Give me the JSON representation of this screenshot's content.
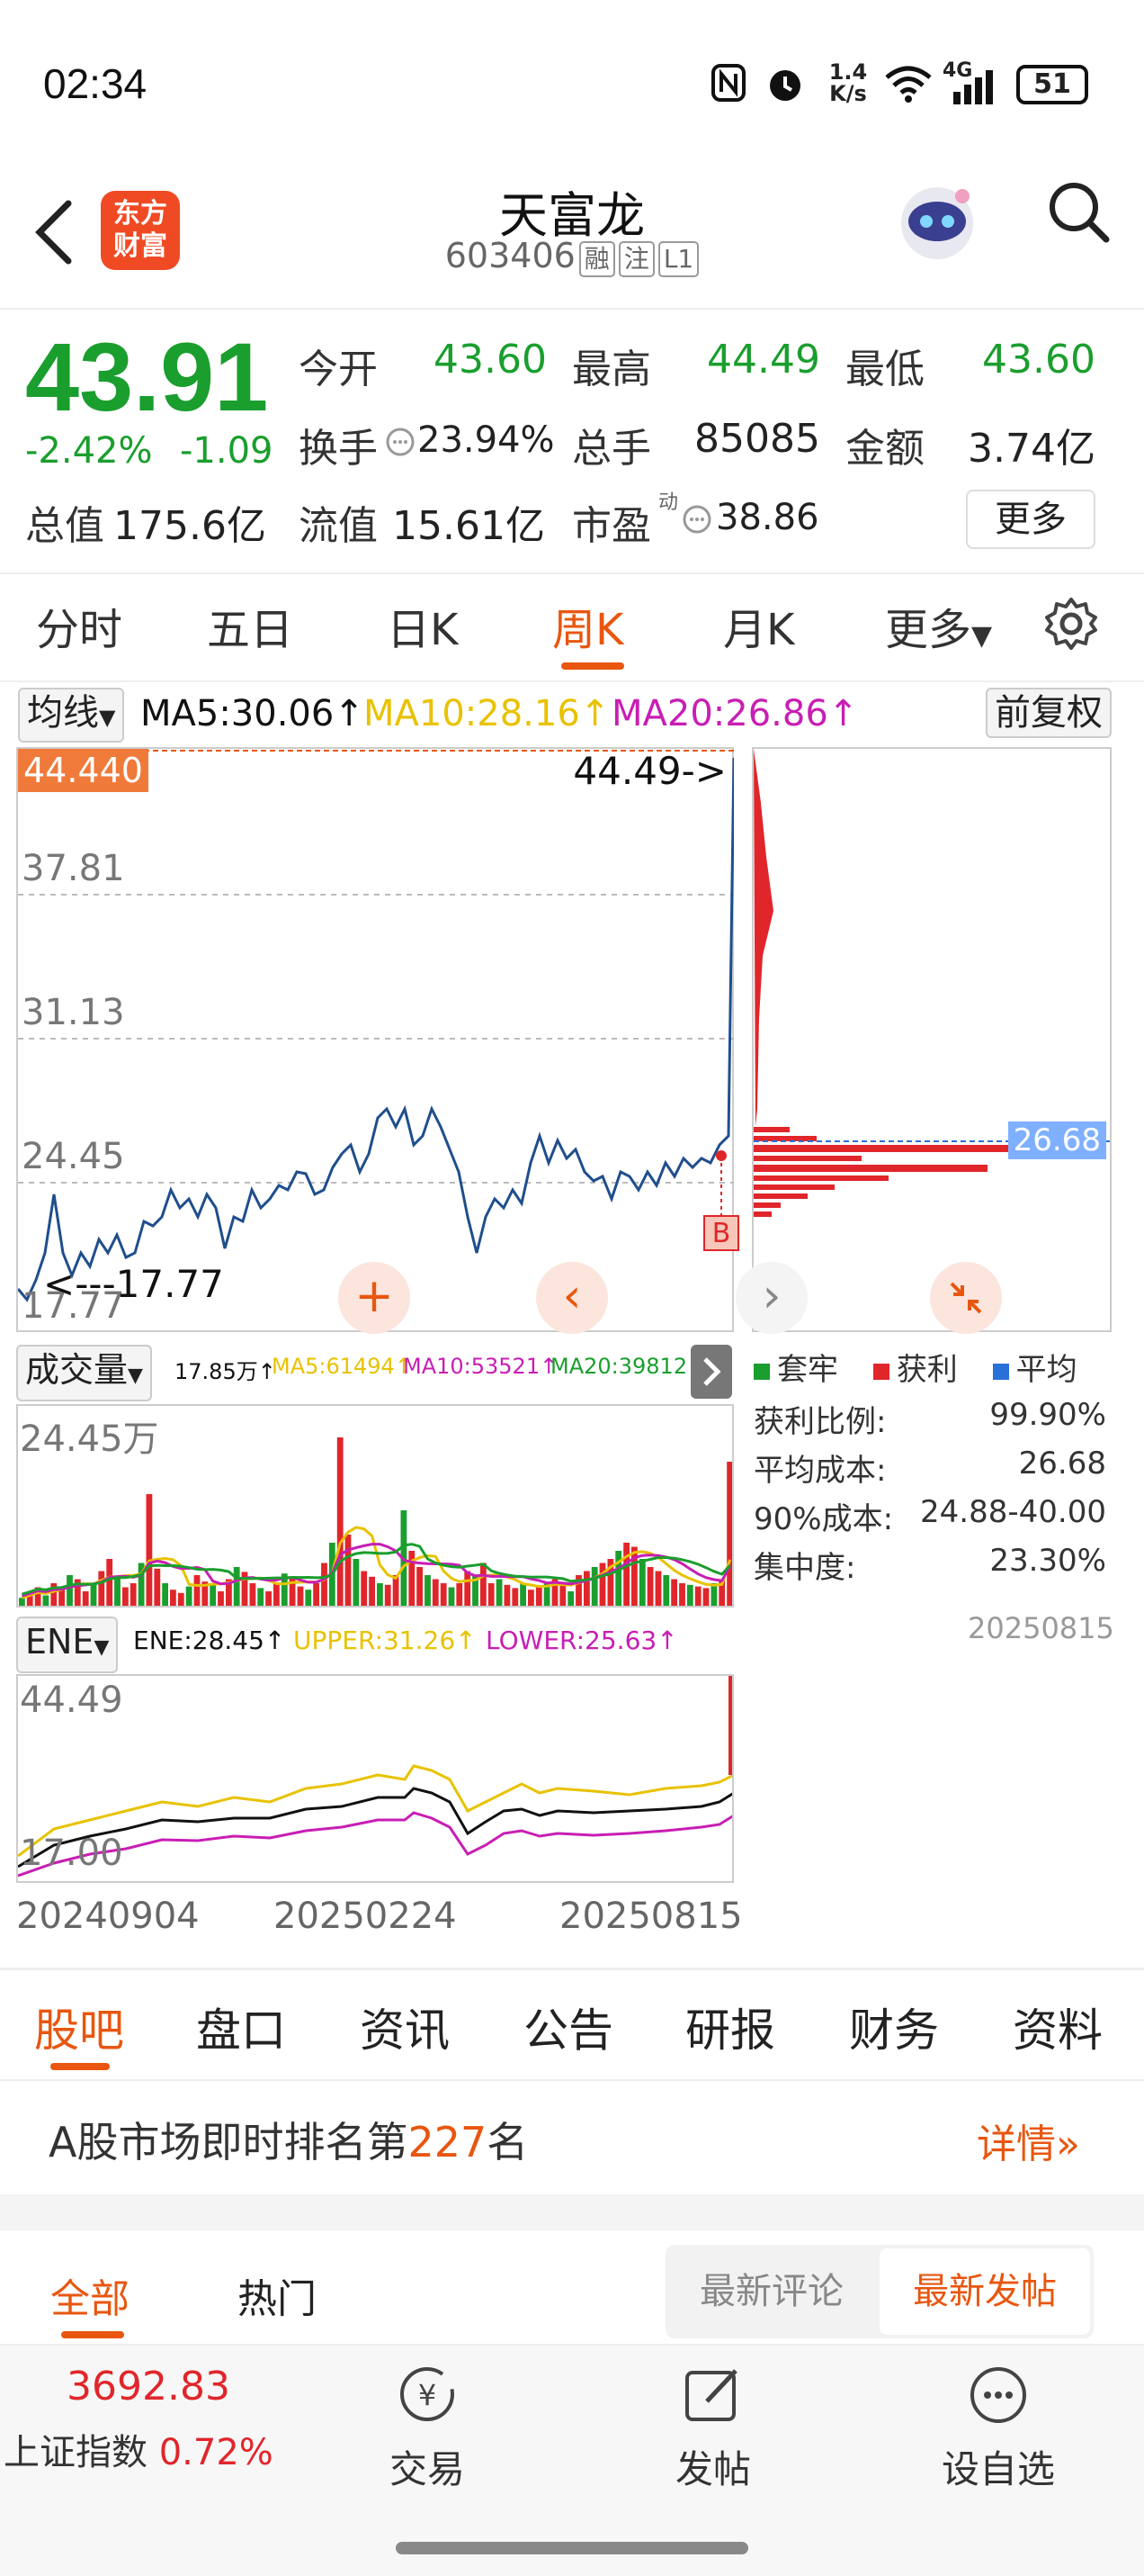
{
  "status": {
    "time": "02:34",
    "speed_top": "1.4",
    "speed_bottom": "K/s",
    "battery": "51",
    "network": "4G"
  },
  "header": {
    "logo_line1": "东方",
    "logo_line2": "财富",
    "title": "天富龙",
    "code": "603406",
    "tags": [
      "融",
      "注",
      "L1"
    ]
  },
  "quote": {
    "price": "43.91",
    "change_pct": "-2.42%",
    "change": "-1.09",
    "fields": [
      {
        "label": "今开",
        "value": "43.60",
        "color": "green"
      },
      {
        "label": "最高",
        "value": "44.49",
        "color": "green"
      },
      {
        "label": "最低",
        "value": "43.60",
        "color": "green"
      },
      {
        "label": "换手",
        "value": "23.94%",
        "color": "dark"
      },
      {
        "label": "总手",
        "value": "85085",
        "color": "dark"
      },
      {
        "label": "金额",
        "value": "3.74亿",
        "color": "dark"
      },
      {
        "label": "总值",
        "value": "175.6亿",
        "color": "dark"
      },
      {
        "label": "流值",
        "value": "15.61亿",
        "color": "dark"
      },
      {
        "label": "市盈",
        "value": "38.86",
        "color": "dark"
      }
    ],
    "pe_superscript": "动",
    "more_label": "更多"
  },
  "tabs": [
    "分时",
    "五日",
    "日K",
    "周K",
    "月K",
    "更多"
  ],
  "active_tab": "周K",
  "ma_bar": {
    "selector": "均线",
    "ma5": "MA5:30.06↑",
    "ma10": "MA10:28.16↑",
    "ma20": "MA20:26.86↑",
    "adjust": "前复权"
  },
  "kline": {
    "high_tag": "44.440",
    "y_labels": [
      "37.81",
      "31.13",
      "24.45",
      "17.77"
    ],
    "max_annot": "44.49->",
    "min_annot": "<---17.77",
    "buy_marker": "B"
  },
  "chip": {
    "avg_tag": "26.68",
    "legend": [
      "套牢",
      "获利",
      "平均"
    ],
    "stats": [
      {
        "label": "获利比例:",
        "value": "99.90%"
      },
      {
        "label": "平均成本:",
        "value": "26.68"
      },
      {
        "label": "90%成本:",
        "value": "24.88-40.00"
      },
      {
        "label": "集中度:",
        "value": "23.30%"
      }
    ],
    "date": "20250815"
  },
  "volume": {
    "selector": "成交量",
    "current": "17.85万↑",
    "ma5": "MA5:61494↑",
    "ma10": "MA10:53521↑",
    "ma20": "MA20:39812↑",
    "max_label": "24.45万"
  },
  "ene": {
    "selector": "ENE",
    "ene": "ENE:28.45↑",
    "upper": "UPPER:31.26↑",
    "lower": "LOWER:25.63↑",
    "max_label": "44.49",
    "min_label": "17.00"
  },
  "x_axis": [
    "20240904",
    "20250224",
    "20250815"
  ],
  "sub_tabs": [
    "股吧",
    "盘口",
    "资讯",
    "公告",
    "研报",
    "财务",
    "资料"
  ],
  "active_sub_tab": "股吧",
  "ranking": {
    "prefix": "A股市场即时排名第",
    "rank": "227",
    "suffix": "名",
    "detail": "详情"
  },
  "feed_tabs": {
    "all": "全部",
    "hot": "热门",
    "latest_comment": "最新评论",
    "latest_post": "最新发帖"
  },
  "bottom_nav": {
    "index_value": "3692.83",
    "index_name": "上证指数",
    "index_change": "0.72%",
    "trade": "交易",
    "post": "发帖",
    "watchlist": "设自选"
  },
  "colors": {
    "accent": "#e8560f",
    "up": "#e0262b",
    "down": "#1a9e2e",
    "ma5": "#111111",
    "ma10": "#e8c200",
    "ma20": "#c81eb4",
    "price_line": "#1f4e8c"
  }
}
